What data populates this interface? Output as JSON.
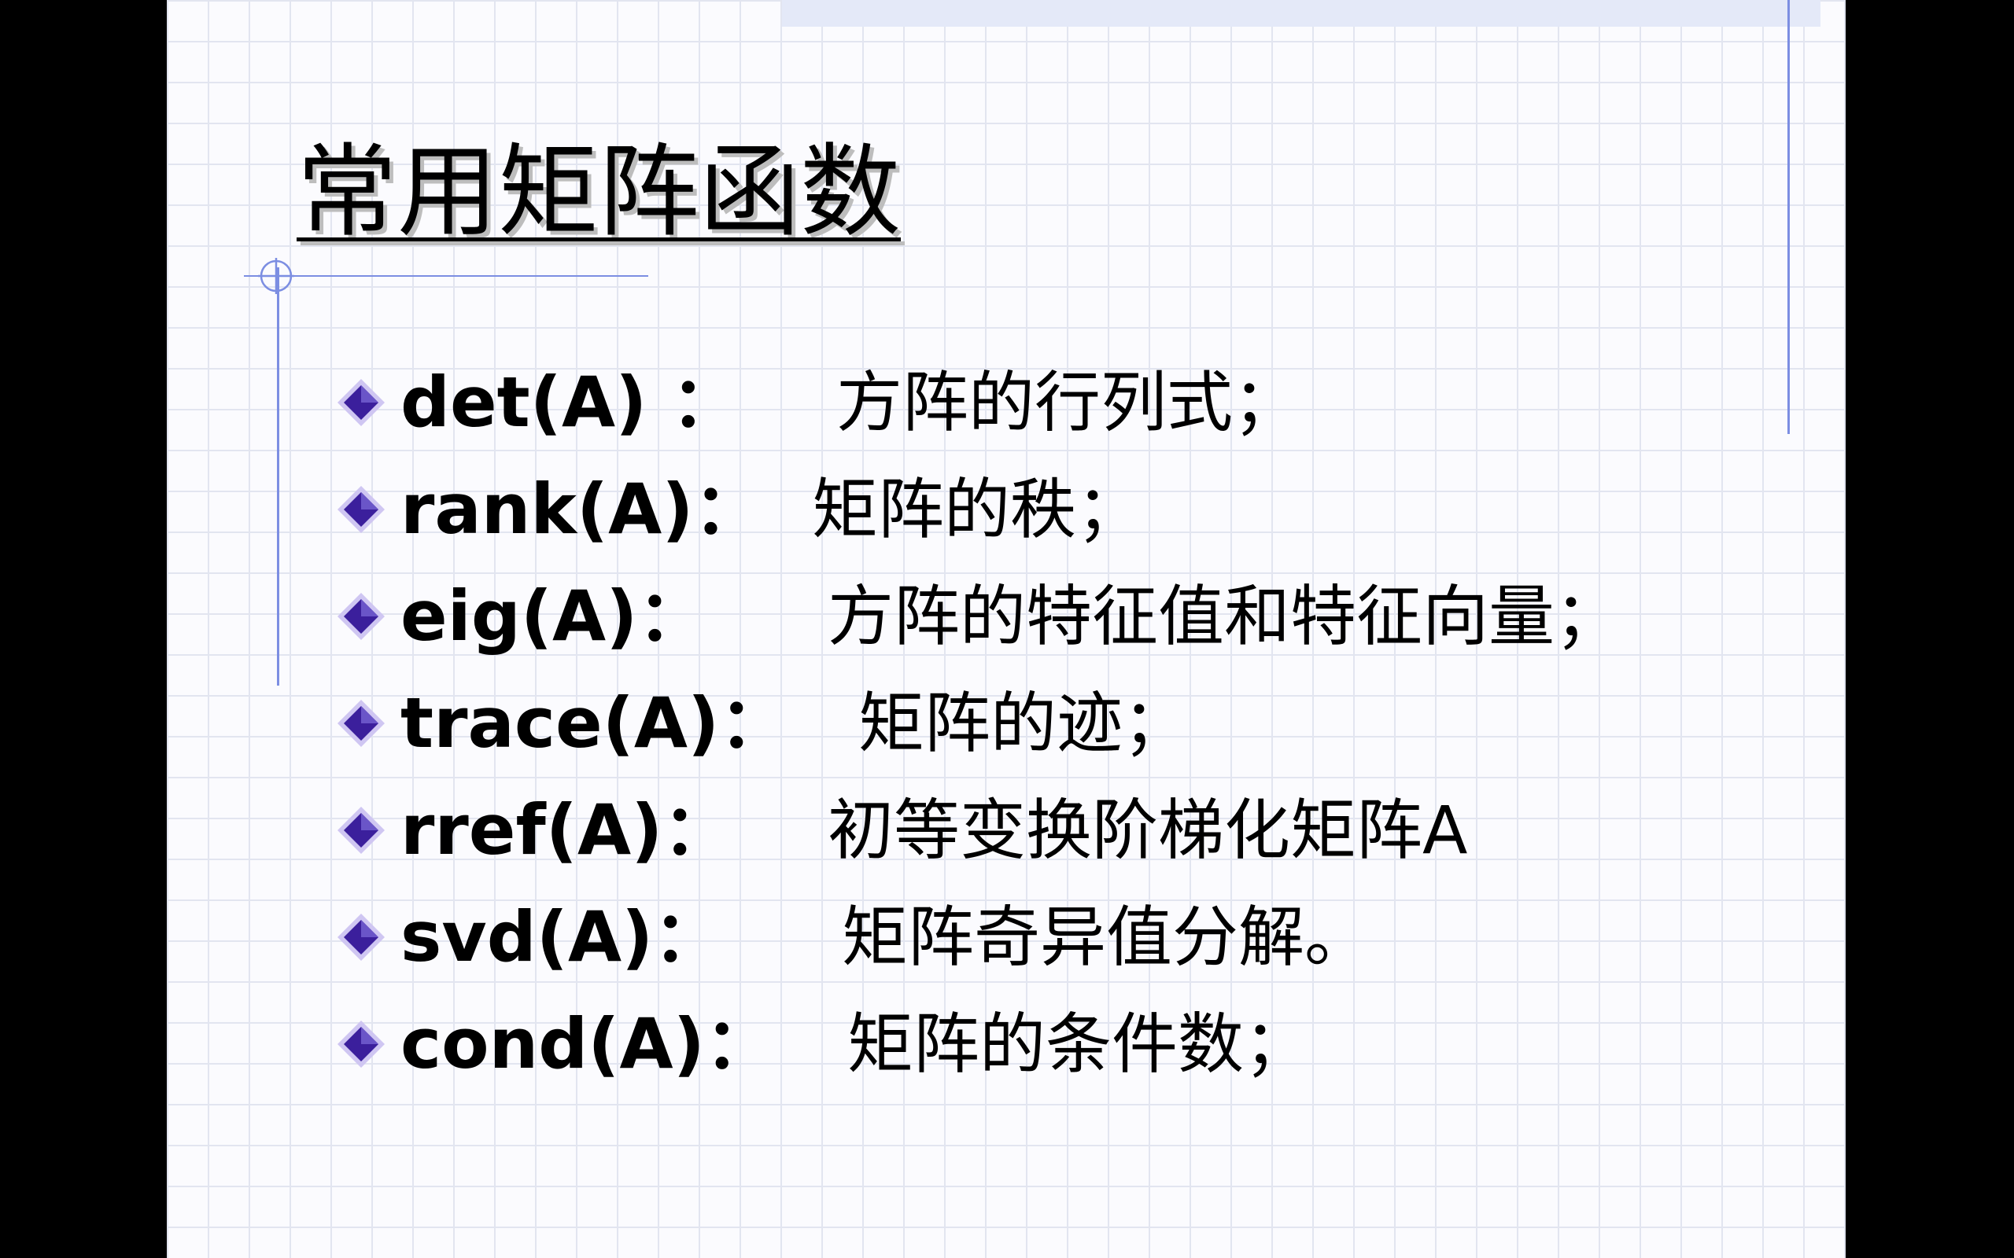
{
  "slide": {
    "title": "常用矩阵函数",
    "items": [
      {
        "fn": "det(A) ：",
        "desc": "方阵的行列式；"
      },
      {
        "fn": "rank(A)：",
        "desc": "矩阵的秩；"
      },
      {
        "fn": "eig(A)：",
        "desc": "方阵的特征值和特征向量；"
      },
      {
        "fn": "trace(A)：",
        "desc": "矩阵的迹；"
      },
      {
        "fn": "rref(A)：",
        "desc": "初等变换阶梯化矩阵A"
      },
      {
        "fn": "svd(A)：",
        "desc": "矩阵奇异值分解。"
      },
      {
        "fn": "cond(A)：",
        "desc": "矩阵的条件数；"
      }
    ]
  },
  "colors": {
    "bullet": "#3b1f9c",
    "rule": "#7c8ee2",
    "grid": "#e2e5f0",
    "background": "#fbfbfe"
  },
  "icons": {
    "bullet": "diamond-bullet-icon",
    "ornament": "crosshair-ornament-icon"
  }
}
